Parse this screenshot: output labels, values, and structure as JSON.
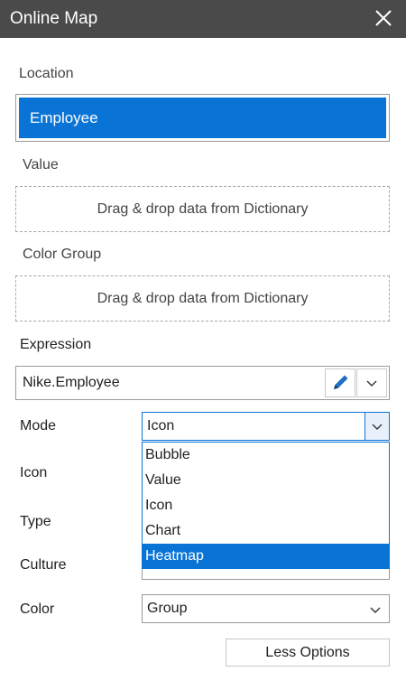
{
  "window": {
    "title": "Online Map"
  },
  "location": {
    "label": "Location",
    "item": "Employee"
  },
  "value": {
    "label": "Value",
    "placeholder": "Drag & drop data from Dictionary"
  },
  "color_group": {
    "label": "Color Group",
    "placeholder": "Drag & drop data from Dictionary"
  },
  "expression": {
    "label": "Expression",
    "value": "Nike.Employee"
  },
  "mode": {
    "label": "Mode",
    "selected": "Icon",
    "options": [
      "Bubble",
      "Value",
      "Icon",
      "Chart",
      "Heatmap"
    ],
    "highlighted": "Heatmap"
  },
  "fields": {
    "icon_label": "Icon",
    "type_label": "Type",
    "culture_label": "Culture",
    "color_label": "Color",
    "color_value": "Group"
  },
  "buttons": {
    "less_options": "Less Options"
  },
  "colors": {
    "accent": "#0a74d6",
    "titlebar": "#4a4a4a"
  }
}
